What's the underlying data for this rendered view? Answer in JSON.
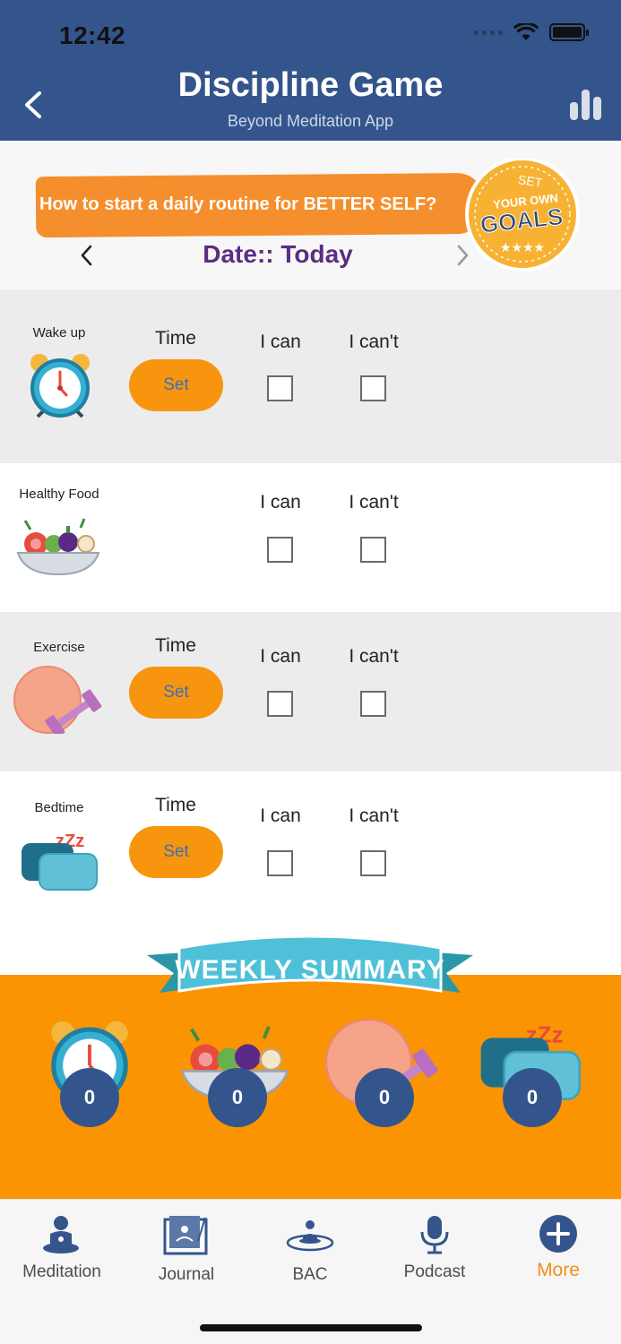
{
  "status_bar": {
    "time": "12:42"
  },
  "header": {
    "title": "Discipline Game",
    "subtitle": "Beyond Meditation App"
  },
  "banner": {
    "promo_text": "How to start a daily routine for BETTER SELF?",
    "badge_lines": [
      "SET",
      "YOUR OWN",
      "GOALS"
    ],
    "date_label": "Date:: Today"
  },
  "columns": {
    "time": "Time",
    "can": "I can",
    "cant": "I can't"
  },
  "activities": [
    {
      "name": "Wake up",
      "has_time": true,
      "set_label": "Set"
    },
    {
      "name": "Healthy Food",
      "has_time": false
    },
    {
      "name": "Exercise",
      "has_time": true,
      "set_label": "Set"
    },
    {
      "name": "Bedtime",
      "has_time": true,
      "set_label": "Set"
    }
  ],
  "weekly_summary": {
    "title": "WEEKLY SUMMARY",
    "counts": [
      "0",
      "0",
      "0",
      "0"
    ]
  },
  "nav": {
    "items": [
      "Meditation",
      "Journal",
      "BAC",
      "Podcast",
      "More"
    ],
    "active": "More"
  },
  "colors": {
    "header": "#34558c",
    "accent_orange": "#f7950e",
    "summary_bg": "#fb9403",
    "date_purple": "#5a2d81",
    "nav_active": "#f58e1b"
  }
}
